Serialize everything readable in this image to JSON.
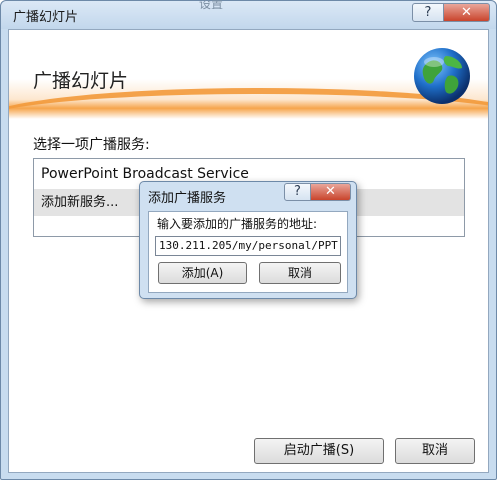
{
  "window": {
    "title": "广播幻灯片",
    "ghost_title": "设置",
    "help_label": "?",
    "close_label": "✕"
  },
  "header": {
    "title": "广播幻灯片"
  },
  "main": {
    "section_label": "选择一项广播服务:",
    "services": [
      {
        "label": "PowerPoint Broadcast Service"
      },
      {
        "label": "添加新服务..."
      }
    ],
    "start_button": "启动广播(S)",
    "cancel_button": "取消"
  },
  "dialog": {
    "title": "添加广播服务",
    "help_label": "?",
    "close_label": "✕",
    "prompt": "输入要添加的广播服务的地址:",
    "input_value": "130.211.205/my/personal/PPT",
    "add_button": "添加(A)",
    "cancel_button": "取消"
  },
  "colors": {
    "accent_orange": "#f39a3b",
    "frame_blue": "#c8dcef"
  }
}
